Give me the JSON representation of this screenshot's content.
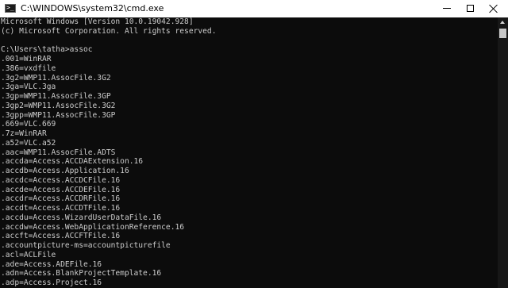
{
  "window": {
    "title": "C:\\WINDOWS\\system32\\cmd.exe",
    "icon": "cmd-prompt-icon",
    "icon_glyph": ">_",
    "controls": [
      "minimize-icon",
      "maximize-icon",
      "close-icon"
    ]
  },
  "colors": {
    "titlebar_bg": "#ffffff",
    "console_bg": "#0c0c0c",
    "console_text": "#cccccc",
    "scrollbar_track": "#171717",
    "scrollbar_thumb": "#c8c8c8"
  },
  "console": {
    "lines": [
      "Microsoft Windows [Version 10.0.19042.928]",
      "(c) Microsoft Corporation. All rights reserved.",
      "",
      "C:\\Users\\tatha>assoc",
      ".001=WinRAR",
      ".386=vxdfile",
      ".3g2=WMP11.AssocFile.3G2",
      ".3ga=VLC.3ga",
      ".3gp=WMP11.AssocFile.3GP",
      ".3gp2=WMP11.AssocFile.3G2",
      ".3gpp=WMP11.AssocFile.3GP",
      ".669=VLC.669",
      ".7z=WinRAR",
      ".a52=VLC.a52",
      ".aac=WMP11.AssocFile.ADTS",
      ".accda=Access.ACCDAExtension.16",
      ".accdb=Access.Application.16",
      ".accdc=Access.ACCDCFile.16",
      ".accde=Access.ACCDEFile.16",
      ".accdr=Access.ACCDRFile.16",
      ".accdt=Access.ACCDTFile.16",
      ".accdu=Access.WizardUserDataFile.16",
      ".accdw=Access.WebApplicationReference.16",
      ".accft=Access.ACCFTFile.16",
      ".accountpicture-ms=accountpicturefile",
      ".acl=ACLFile",
      ".ade=Access.ADEFile.16",
      ".adn=Access.BlankProjectTemplate.16",
      ".adp=Access.Project.16"
    ]
  }
}
